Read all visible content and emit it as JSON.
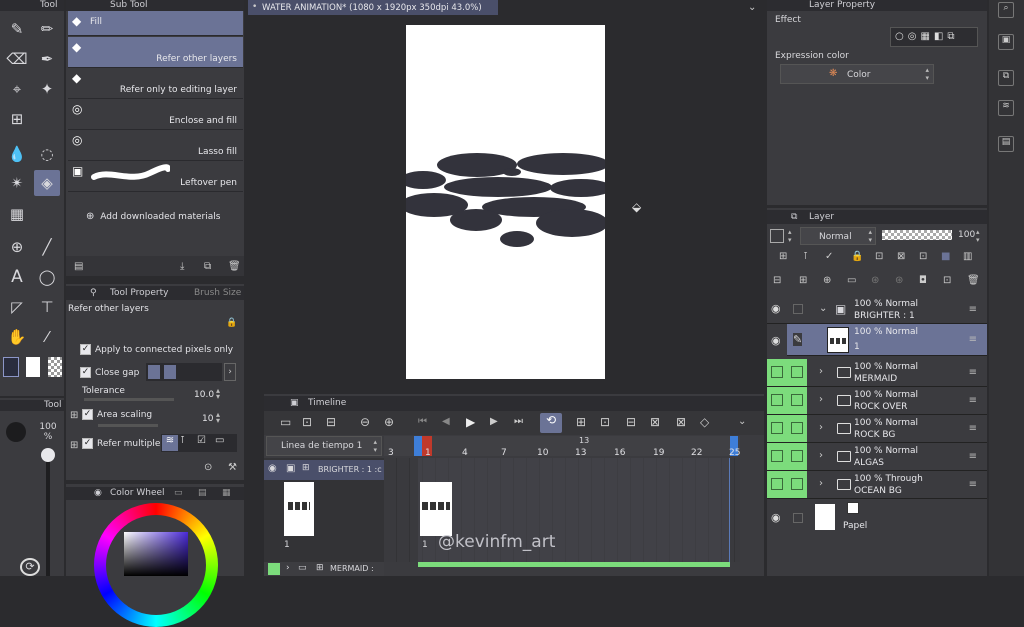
{
  "tool_panel": {
    "title": "Tool"
  },
  "sub_tool": {
    "title": "Sub Tool",
    "items": [
      {
        "label": "Fill"
      },
      {
        "label": "Refer other layers"
      },
      {
        "label": "Refer only to editing layer"
      },
      {
        "label": "Enclose and fill"
      },
      {
        "label": "Lasso fill"
      },
      {
        "label": "Leftover pen"
      }
    ],
    "add_materials": "Add downloaded materials"
  },
  "tool_property": {
    "tab1": "Tool Property",
    "tab2": "Brush Size",
    "current": "Refer other layers",
    "apply_connected": "Apply to connected pixels only",
    "close_gap": "Close gap",
    "tolerance_label": "Tolerance",
    "tolerance_value": "10.0",
    "area_scaling_label": "Area scaling",
    "area_scaling_value": "10",
    "refer_multiple": "Refer multiple"
  },
  "brush_size": {
    "title": "Tool",
    "percent": "100\n%"
  },
  "color_wheel": {
    "title": "Color Wheel"
  },
  "canvas": {
    "title": "WATER ANIMATION* (1080 x 1920px 350dpi 43.0%)"
  },
  "layer_property": {
    "title": "Layer Property",
    "effect_label": "Effect",
    "expression_label": "Expression color",
    "expression_value": "Color"
  },
  "layer_panel": {
    "title": "Layer",
    "blend_mode": "Normal",
    "opacity": "100",
    "layers": [
      {
        "line1": "100 % Normal",
        "line2": "BRIGHTER : 1"
      },
      {
        "line1": "100 % Normal",
        "line2": "1"
      },
      {
        "line1": "100 % Normal",
        "line2": "MERMAID"
      },
      {
        "line1": "100 % Normal",
        "line2": "ROCK OVER"
      },
      {
        "line1": "100 % Normal",
        "line2": "ROCK BG"
      },
      {
        "line1": "100 % Normal",
        "line2": "ALGAS"
      },
      {
        "line1": "100 % Through",
        "line2": "OCEAN BG"
      },
      {
        "line1": "Papel",
        "line2": ""
      }
    ]
  },
  "timeline": {
    "title": "Timeline",
    "timeline_name": "Linea de tiempo 1",
    "tracks": [
      {
        "label": "BRIGHTER : 1 :c"
      },
      {
        "label": "MERMAID :"
      }
    ],
    "frame_label": "1",
    "ticks": [
      "3",
      "1",
      "4",
      "7",
      "10",
      "13",
      "16",
      "19",
      "22",
      "25"
    ],
    "marker_13": "13",
    "marker_1": "1"
  },
  "watermark": "@kevinfm_art",
  "colors": {
    "accent": "#6b7396",
    "green": "#7cdc7c",
    "panel": "#3b3b3f",
    "canvas_bg": "#2b2b2e"
  }
}
